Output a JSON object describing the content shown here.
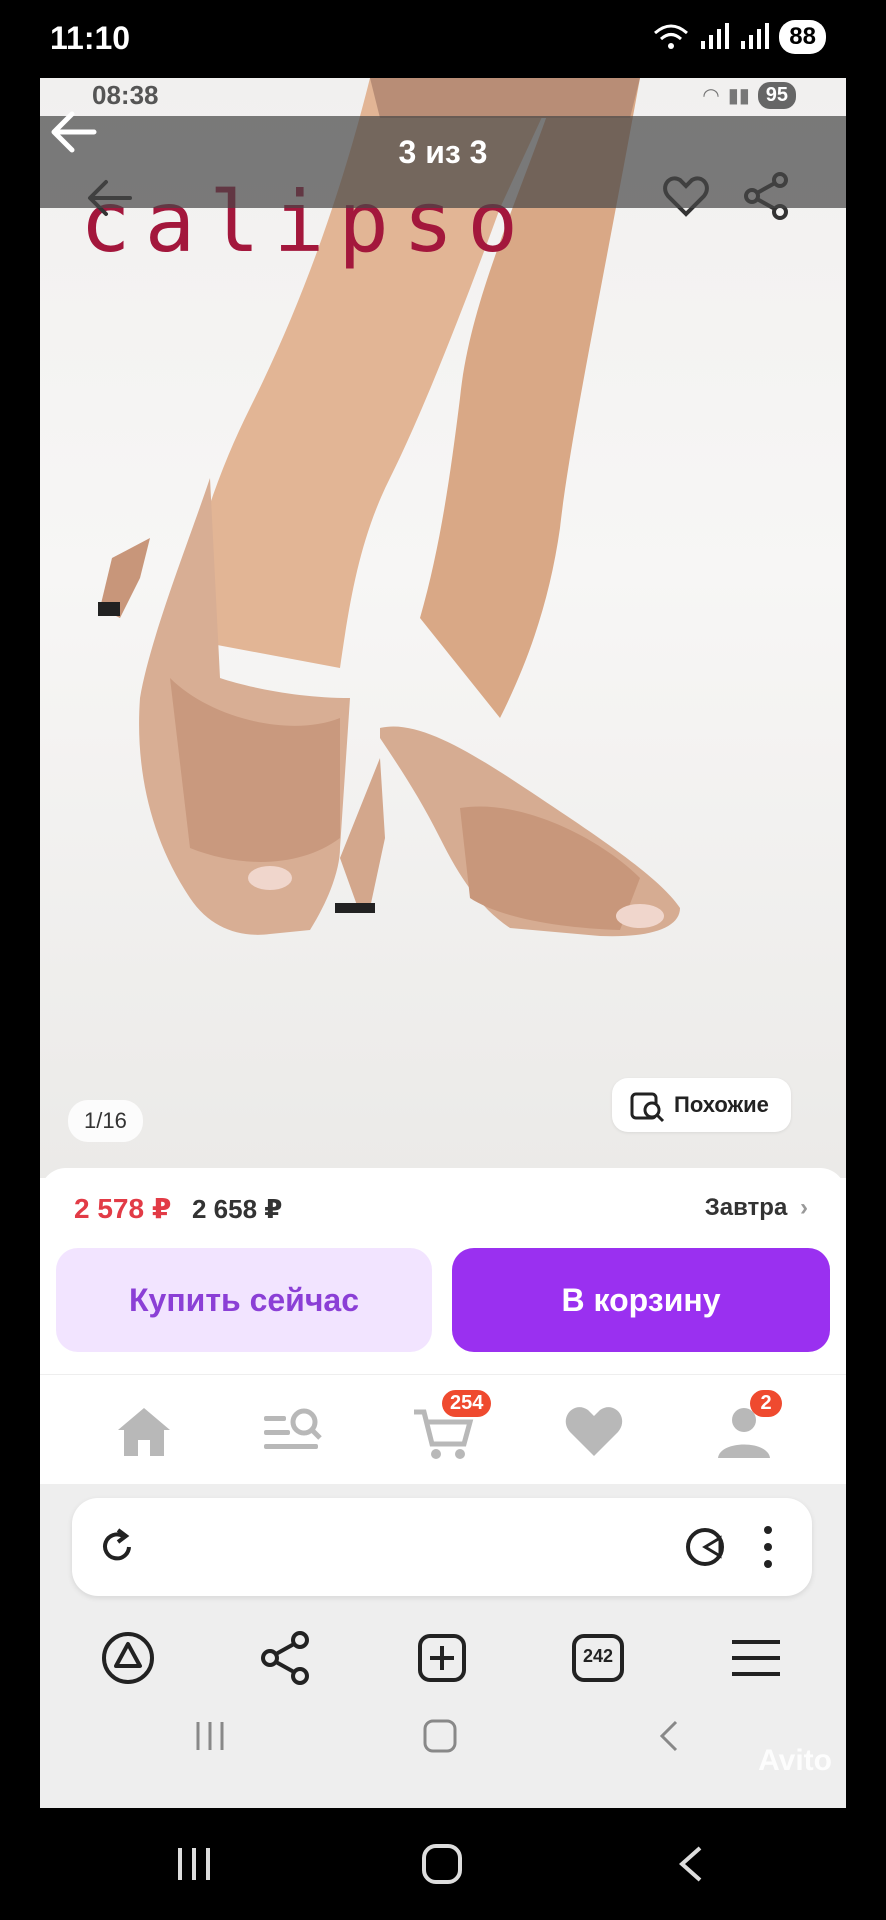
{
  "device": {
    "time": "11:10",
    "battery": "88"
  },
  "screenshot": {
    "inner_time": "08:38",
    "inner_battery": "95",
    "viewer_title": "3 из 3",
    "brand": "calipso",
    "photo_counter": "1/16",
    "similar_label": "Похожие",
    "price_current": "2 578 ₽",
    "price_old": "2 658 ₽",
    "delivery_label": "Завтра",
    "buy_now_label": "Купить сейчас",
    "add_to_cart_label": "В корзину",
    "cart_badge": "254",
    "profile_badge": "2",
    "tabs_count": "242",
    "watermark": "Avito"
  },
  "colors": {
    "accent": "#9a30f0",
    "price": "#e23b46",
    "badge": "#ef4a2f",
    "brand": "#a3173c"
  }
}
